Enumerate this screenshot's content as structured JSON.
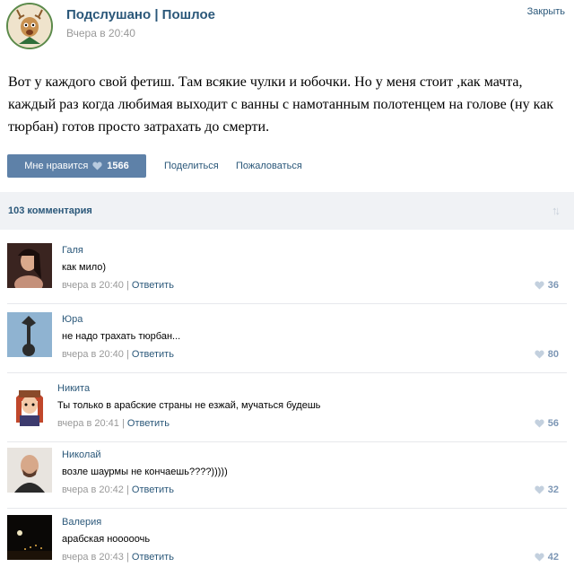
{
  "post": {
    "group_name": "Подслушано | Пошлое",
    "time": "Вчера в 20:40",
    "close_label": "Закрыть",
    "text": "Вот у каждого свой фетиш. Там всякие чулки и юбочки. Но у меня стоит ,как мачта, каждый раз когда любимая выходит с ванны с намотанным полотенцем на голове (ну как тюрбан) готов просто затрахать до смерти.",
    "like_label": "Мне нравится",
    "like_count": "1566",
    "share_label": "Поделиться",
    "report_label": "Пожаловаться"
  },
  "comments_header": {
    "count_label": "103 комментария",
    "sort_icon": "sort-arrows-icon"
  },
  "comments": [
    {
      "name": "Галя",
      "text": "как мило)",
      "time": "вчера в 20:40",
      "separator": "|",
      "reply": "Ответить",
      "likes": "36"
    },
    {
      "name": "Юра",
      "text": "не надо трахать тюрбан...",
      "time": "вчера в 20:40",
      "separator": "|",
      "reply": "Ответить",
      "likes": "80"
    },
    {
      "name": "Никита",
      "text": "Ты только в арабские страны не езжай, мучаться будешь",
      "time": "вчера в 20:41",
      "separator": "|",
      "reply": "Ответить",
      "likes": "56"
    },
    {
      "name": "Николай",
      "text": "возле шаурмы не кончаешь????)))))",
      "time": "вчера в 20:42",
      "separator": "|",
      "reply": "Ответить",
      "likes": "32"
    },
    {
      "name": "Валерия",
      "text": "арабская нооооочь",
      "time": "вчера в 20:43",
      "separator": "|",
      "reply": "Ответить",
      "likes": "42"
    }
  ],
  "colors": {
    "link": "#2b587a",
    "button": "#5e81a8",
    "muted": "#999999",
    "like": "#7d97b5"
  }
}
